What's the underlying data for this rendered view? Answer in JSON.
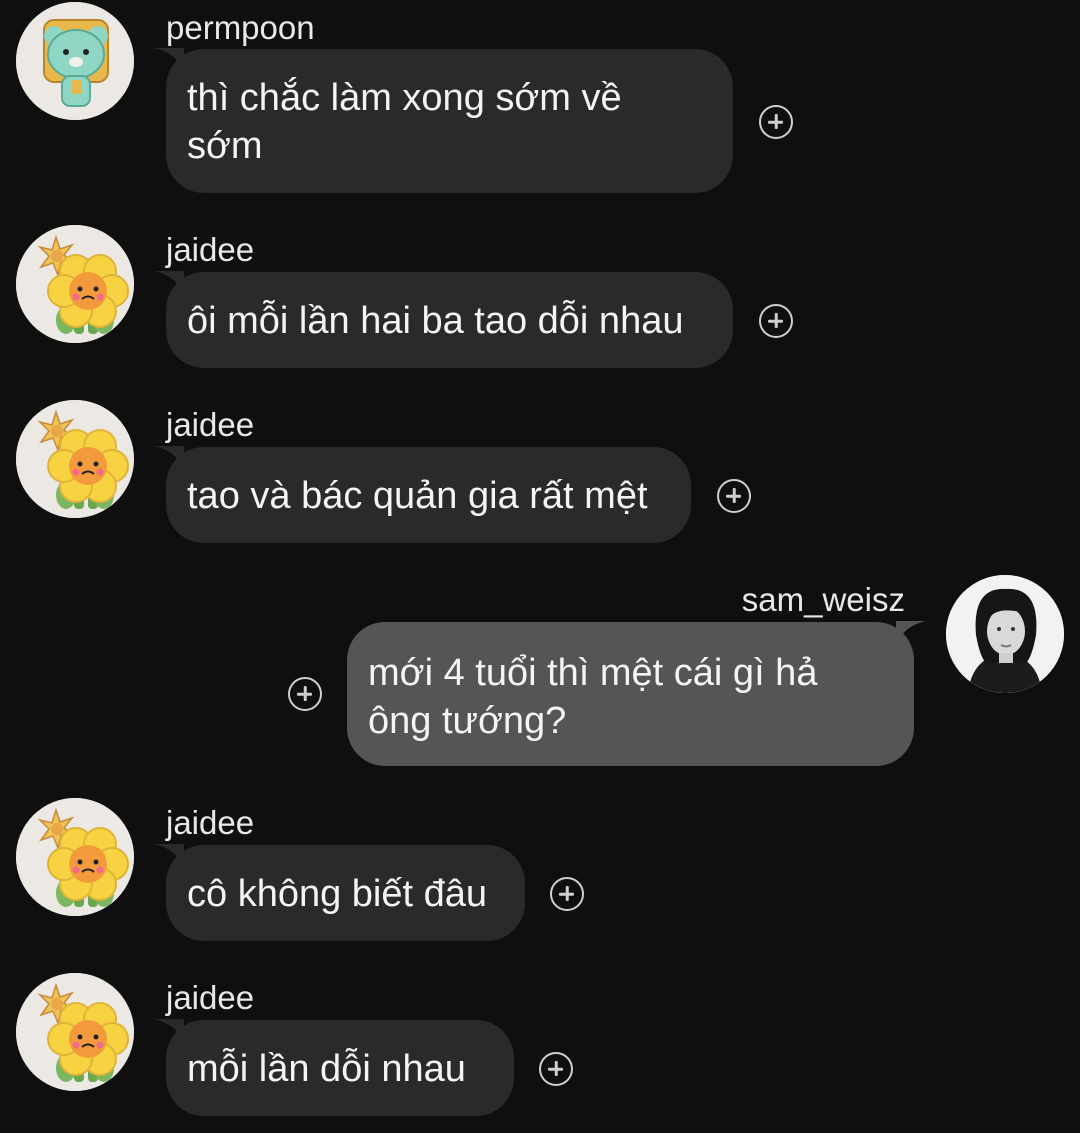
{
  "messages": [
    {
      "sender": "permpoon",
      "text_lines": [
        "thì chắc làm xong sớm về",
        "sớm"
      ],
      "outgoing": false,
      "avatar_icon": "mint-bear-cookie-avatar"
    },
    {
      "sender": "jaidee",
      "text_lines": [
        "ôi mỗi lần hai ba tao dỗi nhau"
      ],
      "outgoing": false,
      "avatar_icon": "flower-cookie-avatar"
    },
    {
      "sender": "jaidee",
      "text_lines": [
        "tao và bác quản gia rất mệt"
      ],
      "outgoing": false,
      "avatar_icon": "flower-cookie-avatar"
    },
    {
      "sender": "sam_weisz",
      "text_lines": [
        "mới 4 tuổi thì mệt cái gì hả",
        "ông tướng?"
      ],
      "outgoing": true,
      "avatar_icon": "portrait-photo-avatar"
    },
    {
      "sender": "jaidee",
      "text_lines": [
        "cô không biết đâu"
      ],
      "outgoing": false,
      "avatar_icon": "flower-cookie-avatar"
    },
    {
      "sender": "jaidee",
      "text_lines": [
        "mỗi lần dỗi nhau"
      ],
      "outgoing": false,
      "avatar_icon": "flower-cookie-avatar"
    }
  ],
  "colors": {
    "background": "#0f0f0f",
    "incoming_bubble": "#2a2a2a",
    "outgoing_bubble": "#555555",
    "text": "#f4f4f4"
  },
  "icons": {
    "react": "add-reaction-icon"
  }
}
